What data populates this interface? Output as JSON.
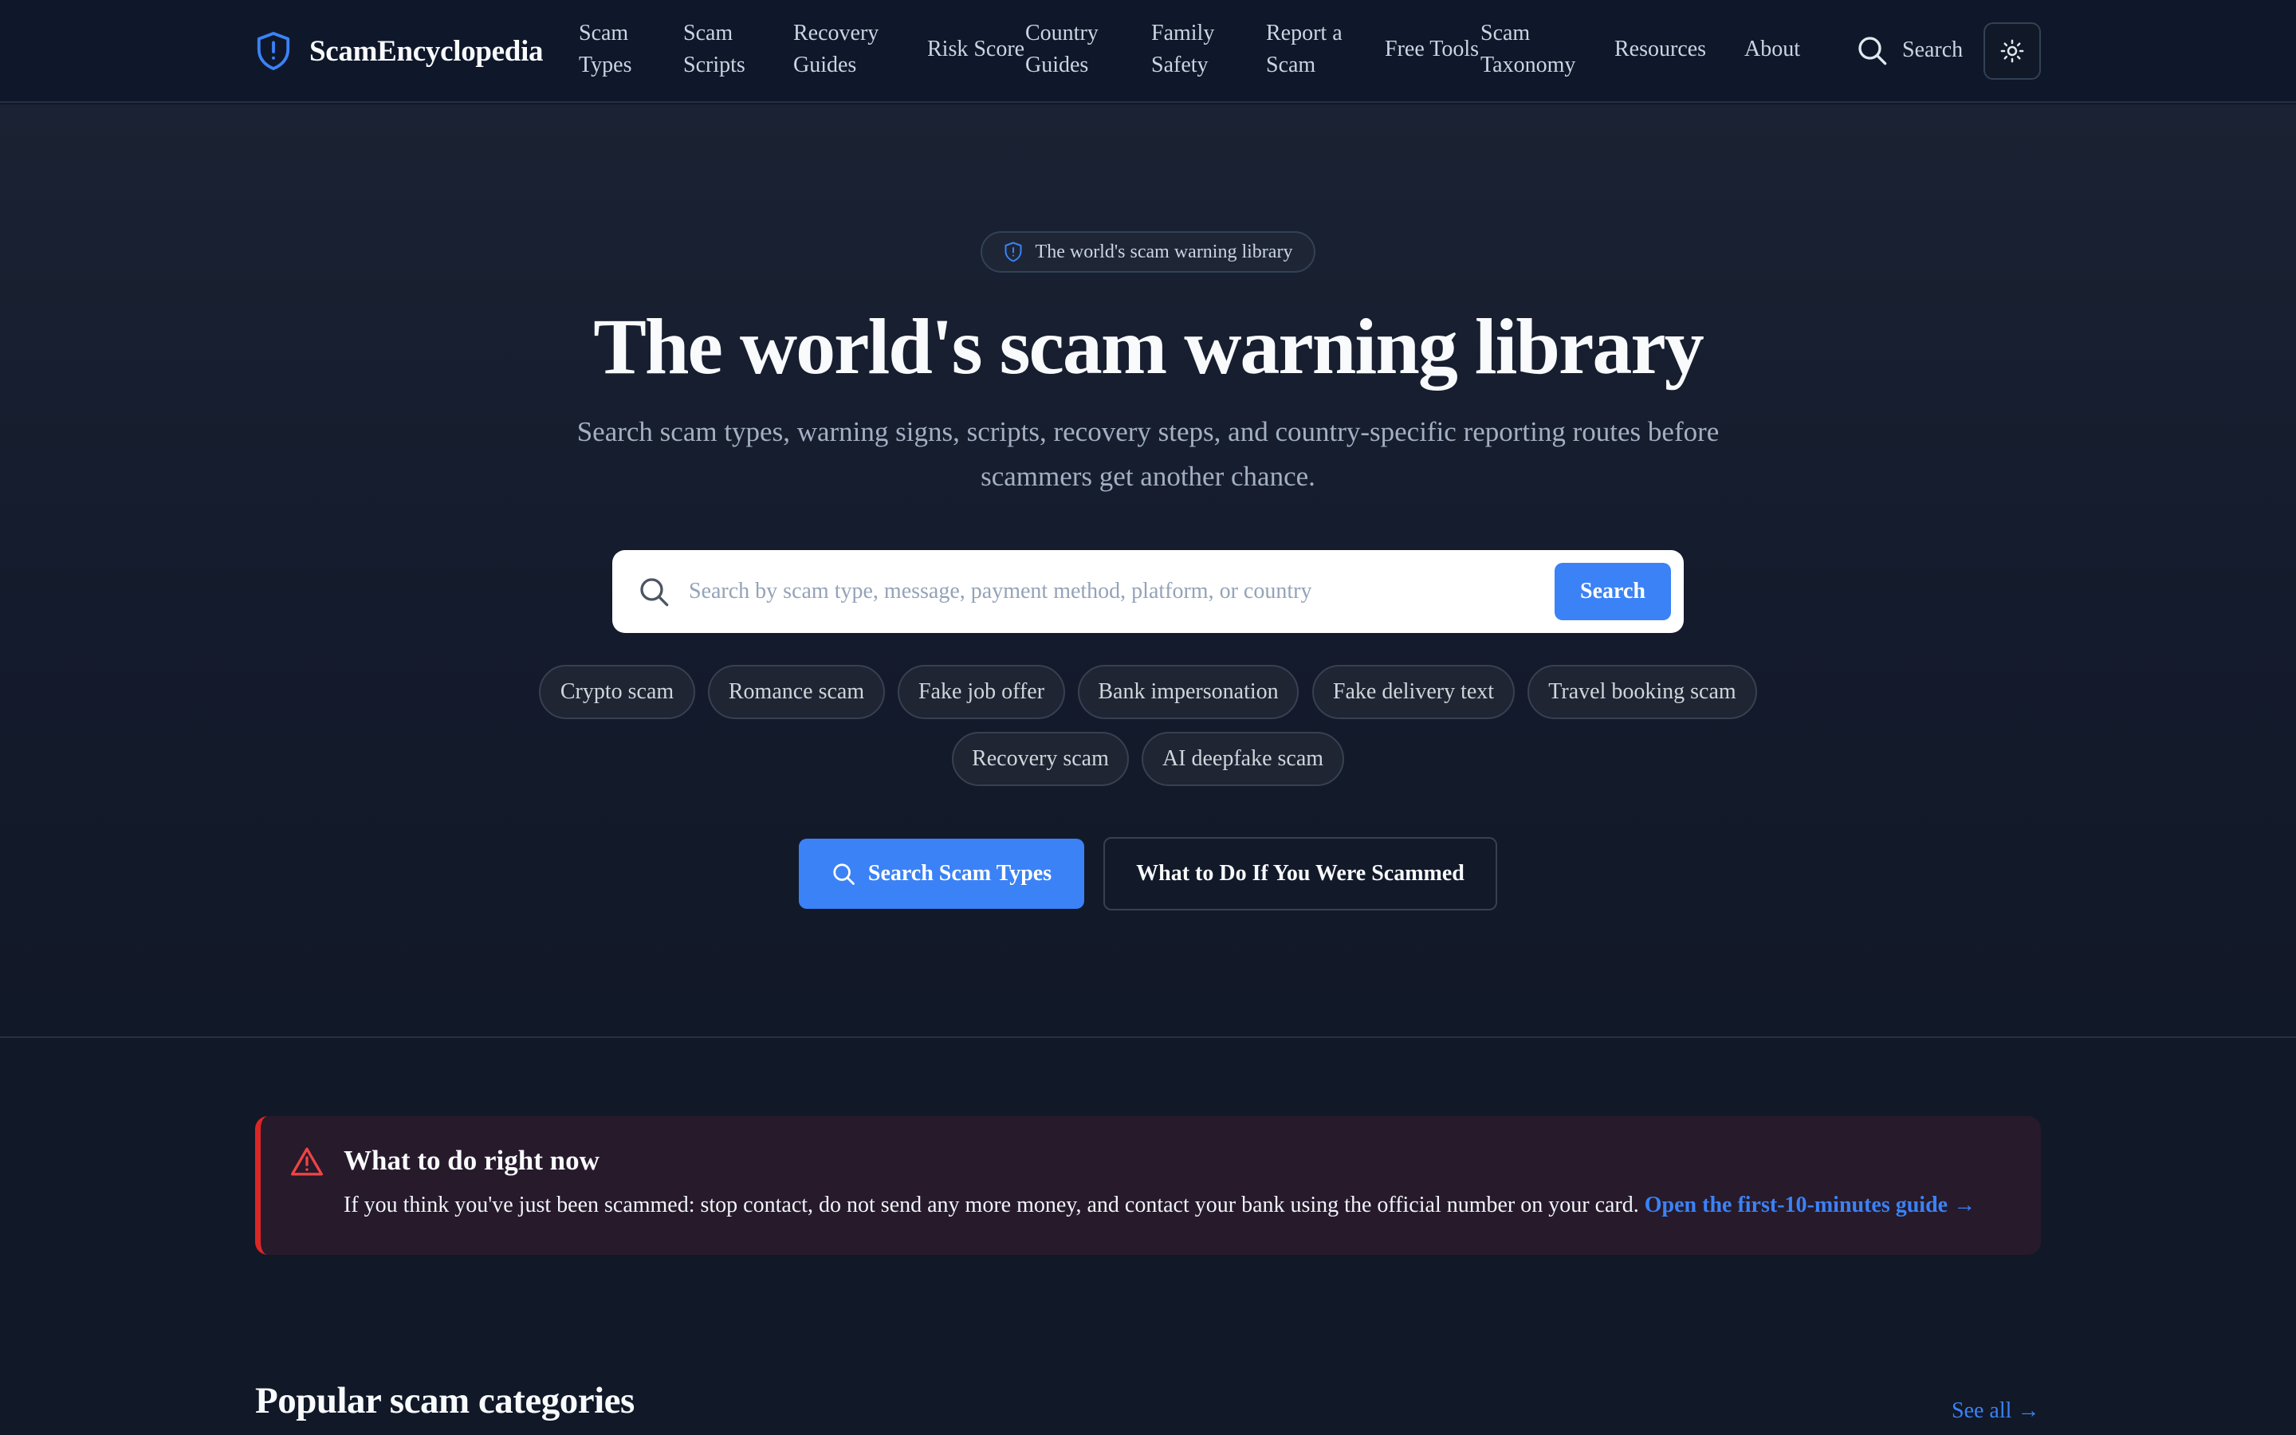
{
  "brand": {
    "name": "ScamEncyclopedia",
    "icon": "shield-alert-icon"
  },
  "nav": {
    "items": [
      {
        "label": "Scam Types"
      },
      {
        "label": "Scam Scripts"
      },
      {
        "label": "Recovery Guides"
      },
      {
        "label": "Risk Score"
      },
      {
        "label": "Country Guides"
      },
      {
        "label": "Family Safety"
      },
      {
        "label": "Report a Scam"
      },
      {
        "label": "Free Tools"
      },
      {
        "label": "Scam Taxonomy"
      },
      {
        "label": "Resources"
      },
      {
        "label": "About"
      }
    ],
    "search_label": "Search",
    "theme_icon": "sun-icon"
  },
  "hero": {
    "eyebrow": "The world's scam warning library",
    "title": "The world's scam warning library",
    "subtitle": "Search scam types, warning signs, scripts, recovery steps, and country-specific reporting routes before scammers get another chance.",
    "search": {
      "placeholder": "Search by scam type, message, payment method, platform, or country",
      "value": "",
      "button_label": "Search"
    },
    "chips": [
      "Crypto scam",
      "Romance scam",
      "Fake job offer",
      "Bank impersonation",
      "Fake delivery text",
      "Travel booking scam",
      "Recovery scam",
      "AI deepfake scam"
    ],
    "primary_cta": "Search Scam Types",
    "secondary_cta": "What to Do If You Were Scammed"
  },
  "alert": {
    "title": "What to do right now",
    "text": "If you think you've just been scammed: stop contact, do not send any more money, and contact your bank using the official number on your card.",
    "link": "Open the first-10-minutes guide →"
  },
  "popular": {
    "title": "Popular scam categories",
    "see_all": "See all →"
  },
  "colors": {
    "accent": "#3b82f6",
    "alert_border": "#dc2626",
    "background": "#111827",
    "header": "#0f172a"
  }
}
